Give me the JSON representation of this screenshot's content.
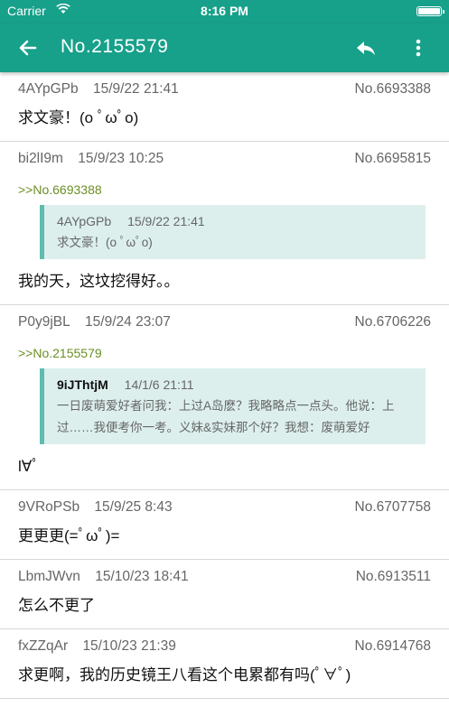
{
  "status_bar": {
    "carrier": "Carrier",
    "time": "8:16 PM"
  },
  "nav": {
    "title": "No.2155579"
  },
  "posts": [
    {
      "user": "4AYpGPb",
      "date": "15/9/22 21:41",
      "no": "No.6693388",
      "content": "求文豪！(o ﾟωﾟo)"
    },
    {
      "user": "bi2lI9m",
      "date": "15/9/23 10:25",
      "no": "No.6695815",
      "quote_ref": ">>No.6693388",
      "quote": {
        "user": "4AYpGPb",
        "date": "15/9/22 21:41",
        "text": "求文豪！(o ﾟωﾟo)"
      },
      "content": "我的天，这坟挖得好。。"
    },
    {
      "user": "P0y9jBL",
      "date": "15/9/24 23:07",
      "no": "No.6706226",
      "quote_ref": ">>No.2155579",
      "quote": {
        "user": "9iJThtjM",
        "date": "14/1/6 21:11",
        "text": "一日废萌爱好者问我：上过A岛麽？我略略点一点头。他说：上过……我便考你一考。义妹&实妹那个好？我想：废萌爱好"
      },
      "content": "l∀ﾟ"
    },
    {
      "user": "9VRoPSb",
      "date": "15/9/25 8:43",
      "no": "No.6707758",
      "content": "更更更(=ﾟωﾟ)="
    },
    {
      "user": "LbmJWvn",
      "date": "15/10/23 18:41",
      "no": "No.6913511",
      "content": "怎么不更了"
    },
    {
      "user": "fxZZqAr",
      "date": "15/10/23 21:39",
      "no": "No.6914768",
      "content": "求更啊，我的历史镜王八看这个电累都有吗(ﾟ∀ﾟ)"
    }
  ]
}
